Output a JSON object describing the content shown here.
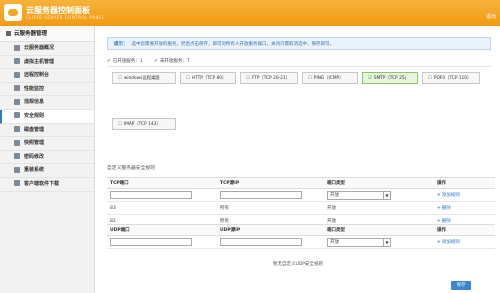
{
  "header": {
    "title": "云服务器控制面板",
    "subtitle": "CLOUD SERVER CONTROL PANEL",
    "right_link": "退出"
  },
  "sidebar": {
    "heading": "云服务器管理",
    "items": [
      {
        "label": "云服务器概况",
        "icon": "overview-icon"
      },
      {
        "label": "虚拟主机管理",
        "icon": "host-icon"
      },
      {
        "label": "远程控制台",
        "icon": "console-icon"
      },
      {
        "label": "性能监控",
        "icon": "monitor-icon"
      },
      {
        "label": "违规信息",
        "icon": "warning-icon"
      },
      {
        "label": "安全规则",
        "icon": "shield-icon",
        "active": true
      },
      {
        "label": "磁盘管理",
        "icon": "disk-icon"
      },
      {
        "label": "快照管理",
        "icon": "snapshot-icon"
      },
      {
        "label": "密码修改",
        "icon": "key-icon"
      },
      {
        "label": "重装系统",
        "icon": "reinstall-icon"
      },
      {
        "label": "客户端软件下载",
        "icon": "download-icon"
      }
    ]
  },
  "notice": {
    "label": "提示：",
    "text": "选中您需要开放的服务，然后点击保存，即可对所有人开放服务端口，关闭只需取消选中，保存即可。"
  },
  "status": {
    "open_label": "已开放服务：1",
    "closed_label": "未开放服务：7"
  },
  "ports": [
    {
      "label": "windows远程桌面",
      "on": false
    },
    {
      "label": "HTTP（TCP 80）",
      "on": false
    },
    {
      "label": "FTP（TCP 20-21）",
      "on": false
    },
    {
      "label": "PING（ICMP）",
      "on": false
    },
    {
      "label": "SMTP（TCP 25）",
      "on": true
    },
    {
      "label": "POP3（TCP 110）",
      "on": false
    },
    {
      "label": "IMAP（TCP 143）",
      "on": false
    }
  ],
  "custom_section_title": "自定义服务器安全规则",
  "tcp_table": {
    "headers": [
      "TCP端口",
      "TCP源IP",
      "端口类型",
      "操作"
    ],
    "input_select_value": "开放",
    "add_label": "添加规则",
    "rows": [
      {
        "port": "83",
        "ip": "所有",
        "type": "开放",
        "action": "删除"
      },
      {
        "port": "82",
        "ip": "所有",
        "type": "开放",
        "action": "删除"
      }
    ]
  },
  "udp_table": {
    "headers": [
      "UDP端口",
      "UDP源IP",
      "端口类型",
      "操作"
    ],
    "input_select_value": "开放",
    "add_label": "添加规则"
  },
  "empty_message": "暂无自定义UDP安全规则",
  "save_label": "保存",
  "colors": {
    "header": "#f5a623",
    "accent": "#2f78c4",
    "active_port": "#e7f5dc",
    "save": "#3b85d1"
  }
}
